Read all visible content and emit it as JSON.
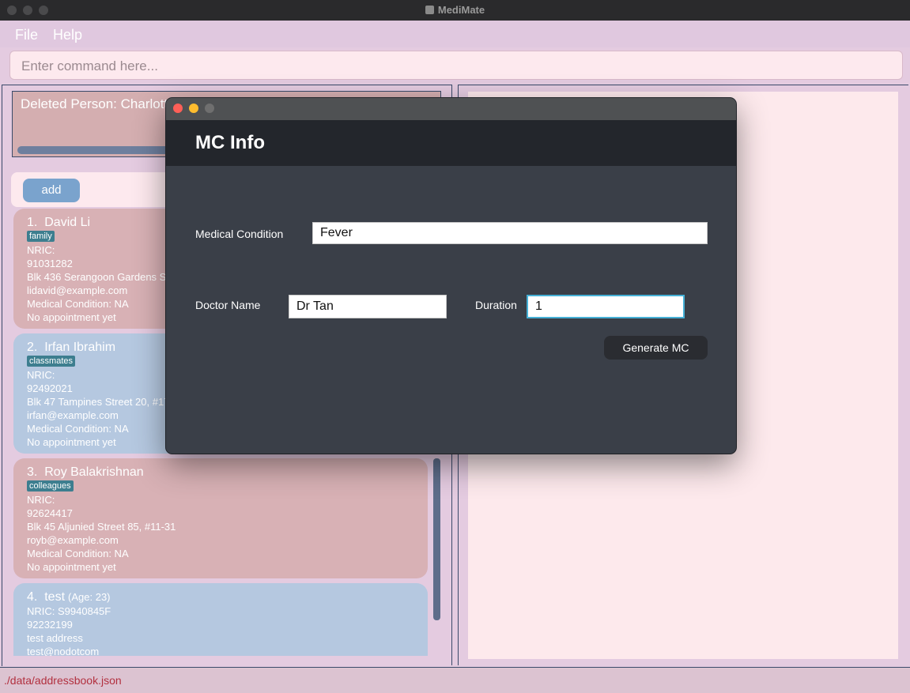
{
  "window": {
    "title": "MediMate"
  },
  "menu": {
    "file": "File",
    "help": "Help"
  },
  "command": {
    "placeholder": "Enter command here..."
  },
  "result": {
    "text": "Deleted Person: Charlotte"
  },
  "list": {
    "add_label": "add",
    "persons": [
      {
        "index": "1.",
        "name": "David Li",
        "age": "",
        "tag": "family",
        "nric": "NRIC:",
        "phone": "91031282",
        "address": "Blk 436 Serangoon Gardens Stre",
        "email": "lidavid@example.com",
        "condition": "Medical Condition: NA",
        "appointment": "No appointment yet"
      },
      {
        "index": "2.",
        "name": "Irfan Ibrahim",
        "age": "",
        "tag": "classmates",
        "nric": "NRIC:",
        "phone": "92492021",
        "address": "Blk 47 Tampines Street 20, #17-",
        "email": "irfan@example.com",
        "condition": "Medical Condition: NA",
        "appointment": "No appointment yet"
      },
      {
        "index": "3.",
        "name": "Roy Balakrishnan",
        "age": "",
        "tag": "colleagues",
        "nric": "NRIC:",
        "phone": "92624417",
        "address": "Blk 45 Aljunied Street 85, #11-31",
        "email": "royb@example.com",
        "condition": "Medical Condition: NA",
        "appointment": "No appointment yet"
      },
      {
        "index": "4.",
        "name": "test",
        "age": "(Age: 23)",
        "tag": "",
        "nric": "NRIC: S9940845F",
        "phone": "92232199",
        "address": "test address",
        "email": "test@nodotcom",
        "condition": "",
        "appointment": ""
      }
    ]
  },
  "status": {
    "path": "./data/addressbook.json"
  },
  "dialog": {
    "heading": "MC Info",
    "condition_label": "Medical Condition",
    "condition_value": "Fever",
    "doctor_label": "Doctor Name",
    "doctor_value": "Dr Tan",
    "duration_label": "Duration",
    "duration_value": "1",
    "generate_label": "Generate MC"
  },
  "colors": {
    "close": "#fe5f57",
    "minimize": "#febc2e",
    "maximize": "#6f6f6f",
    "accent": "#45b0d6"
  }
}
